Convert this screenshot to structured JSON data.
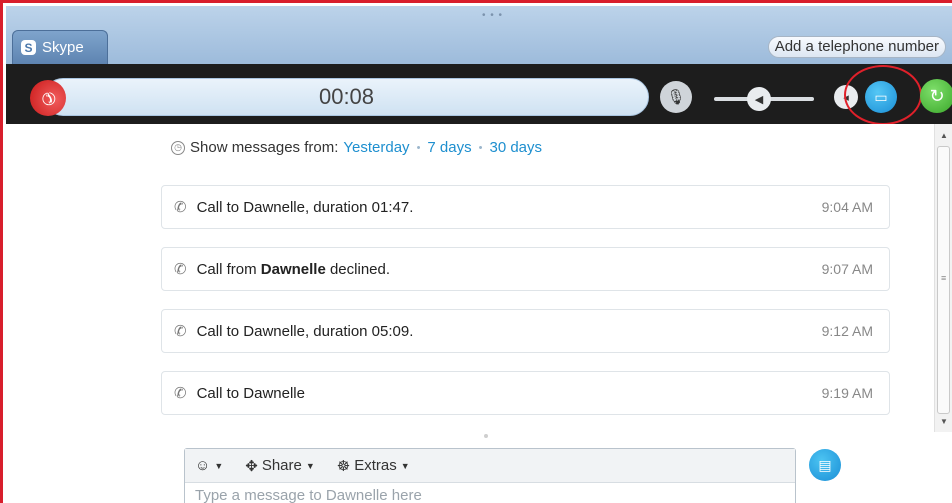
{
  "window": {
    "tab_label": "Skype",
    "add_phone_label": "Add a telephone number"
  },
  "call": {
    "timer": "00:08",
    "volume_level": 0.45
  },
  "history": {
    "show_from_label": "Show messages from:",
    "filters": [
      "Yesterday",
      "7 days",
      "30 days"
    ]
  },
  "messages": [
    {
      "text_before": "Call to Dawnelle, duration 01:47.",
      "bold": "",
      "text_after": "",
      "time": "9:04 AM"
    },
    {
      "text_before": "Call from ",
      "bold": "Dawnelle",
      "text_after": " declined.",
      "time": "9:07 AM"
    },
    {
      "text_before": "Call to Dawnelle, duration 05:09.",
      "bold": "",
      "text_after": "",
      "time": "9:12 AM"
    },
    {
      "text_before": "Call to Dawnelle",
      "bold": "",
      "text_after": "",
      "time": "9:19 AM"
    }
  ],
  "compose": {
    "emoticon_label": "☺",
    "share_label": "Share",
    "extras_label": "Extras",
    "placeholder": "Type a message to Dawnelle here"
  },
  "colors": {
    "accent": "#1e8fcf",
    "hangup": "#c81717",
    "call_green": "#3aa72a",
    "annotation_ring": "#e0202a"
  },
  "icons": {
    "hangup": "hangup-icon",
    "mic": "microphone-icon",
    "volume": "volume-icon",
    "video": "video-camera-icon",
    "callback": "call-back-icon",
    "clock": "clock-icon",
    "phone": "phone-icon",
    "send": "send-icon"
  }
}
